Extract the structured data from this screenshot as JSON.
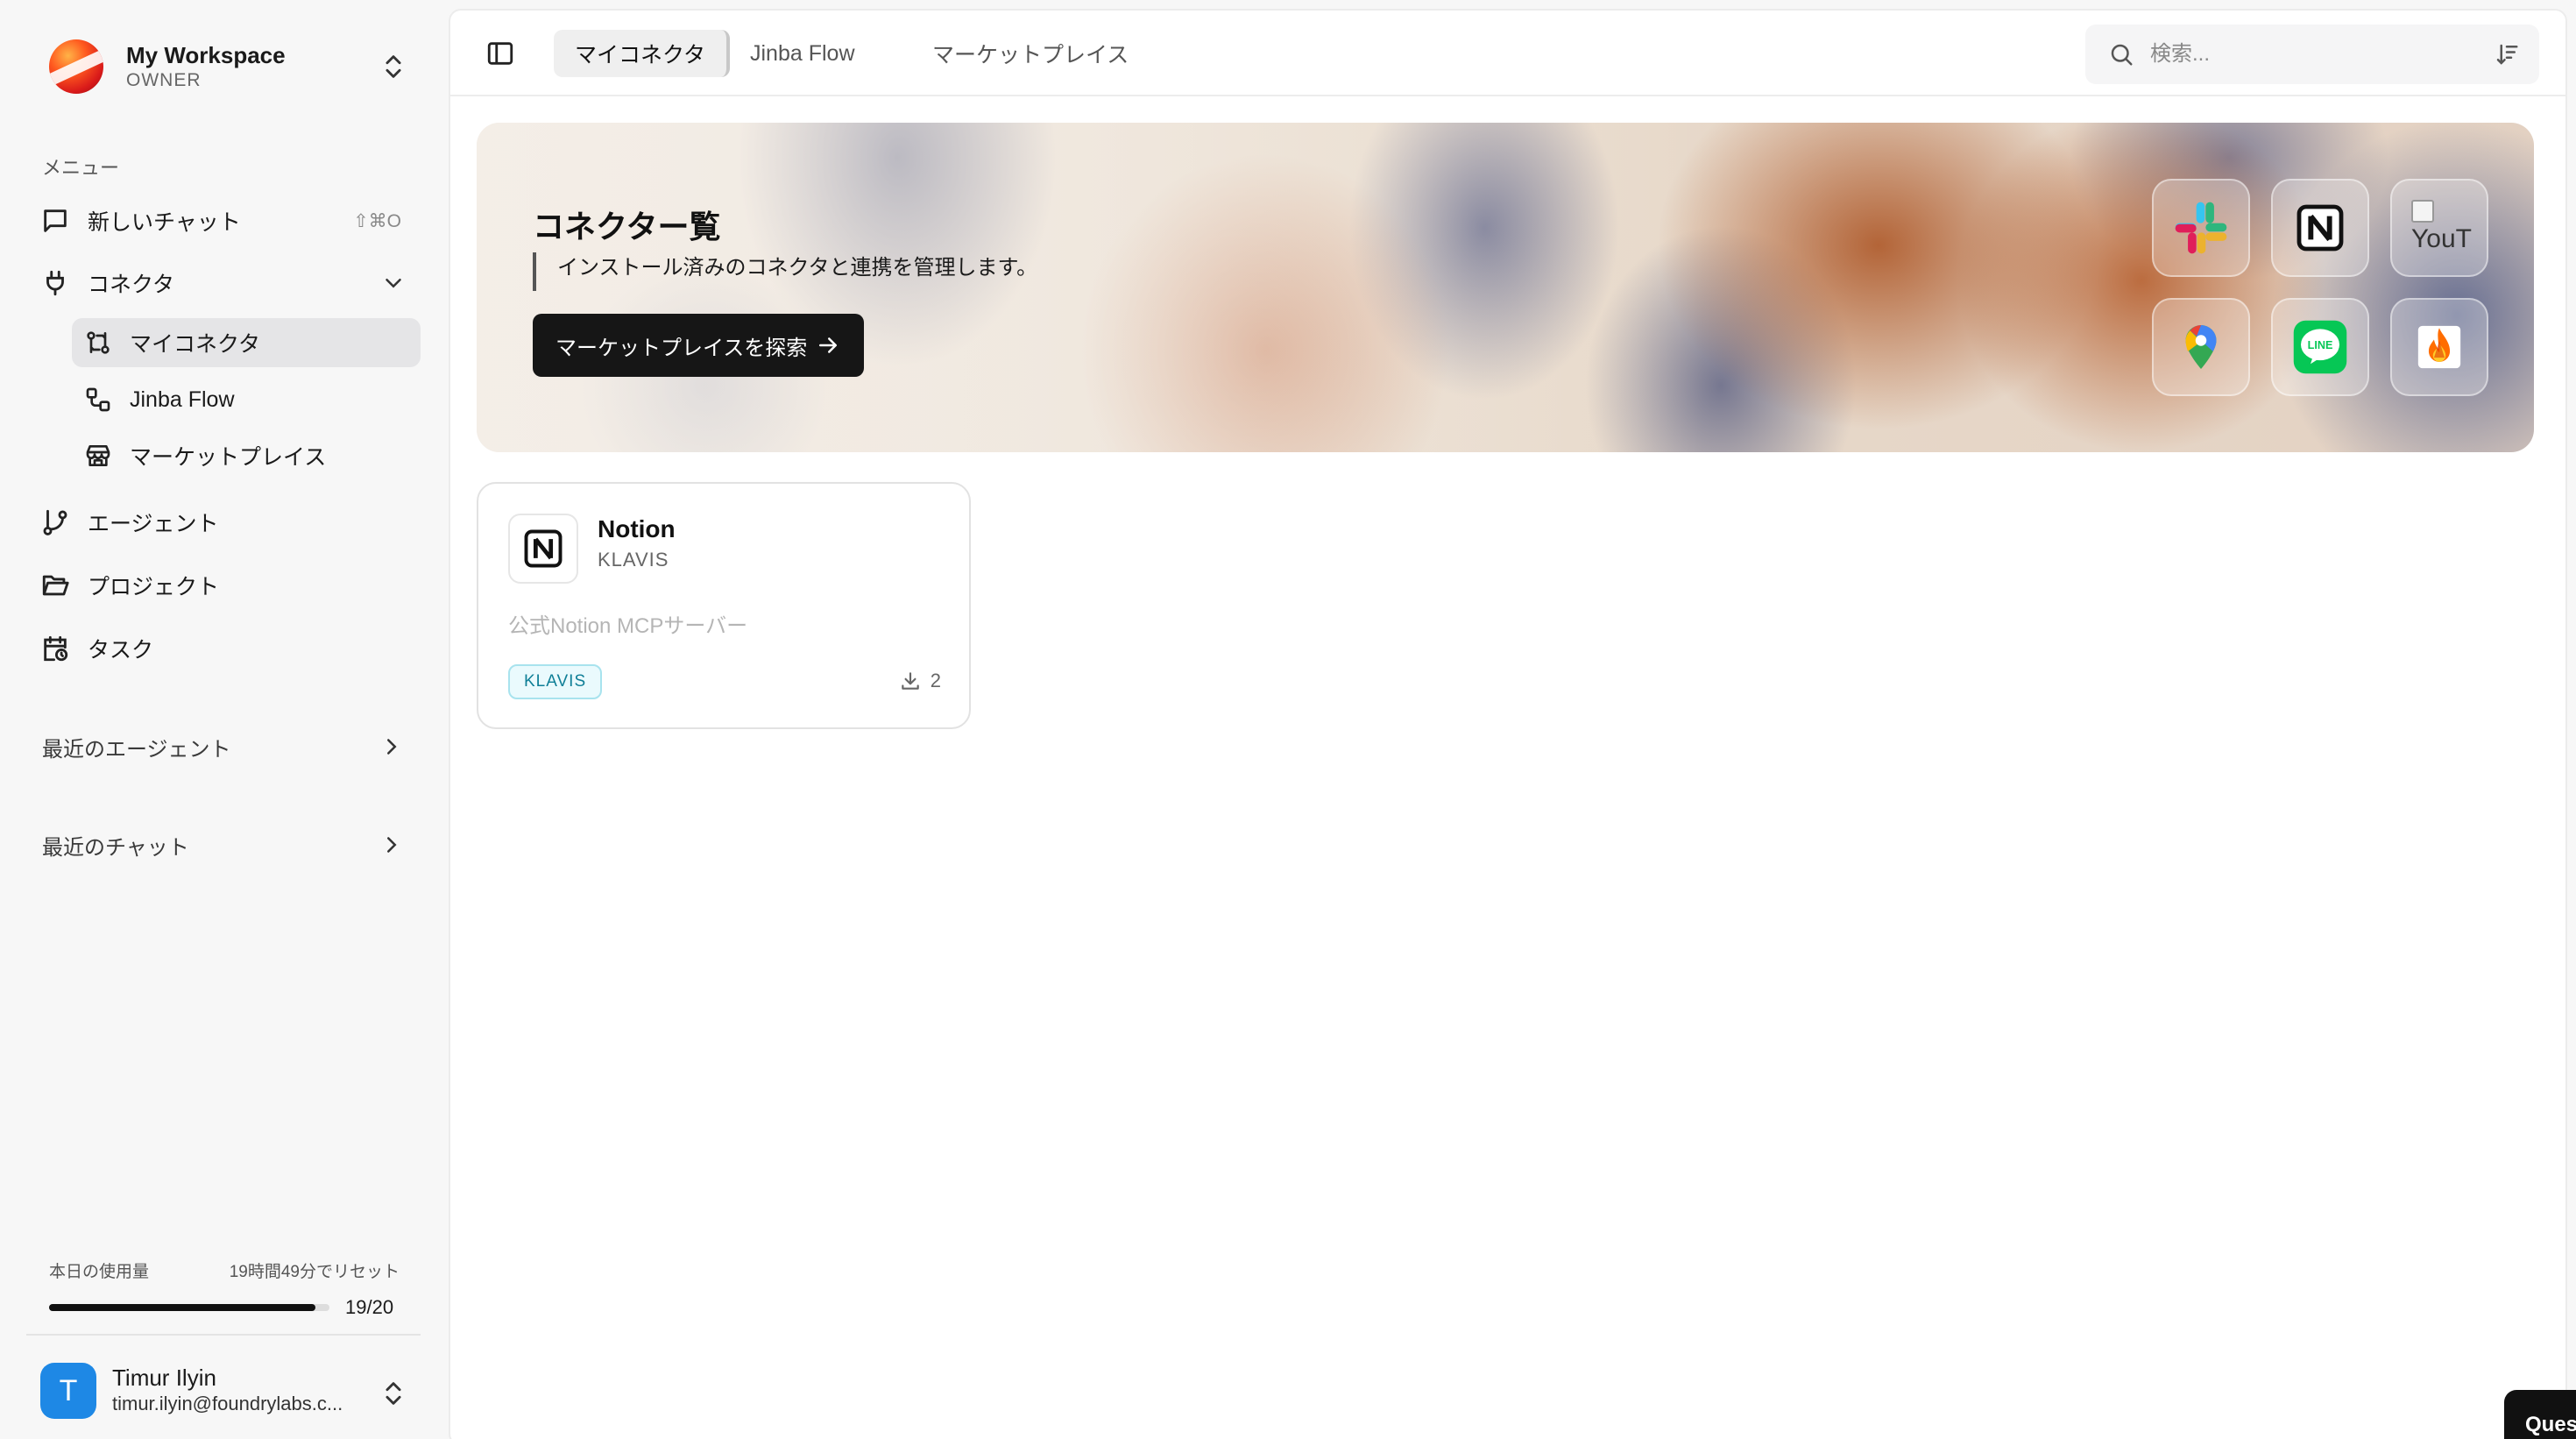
{
  "workspace": {
    "name": "My Workspace",
    "role": "OWNER"
  },
  "sidebar": {
    "menu_label": "メニュー",
    "new_chat": {
      "label": "新しいチャット",
      "shortcut": "⇧⌘O"
    },
    "connectors": {
      "label": "コネクタ",
      "items": [
        {
          "label": "マイコネクタ",
          "active": true
        },
        {
          "label": "Jinba Flow"
        },
        {
          "label": "マーケットプレイス"
        }
      ]
    },
    "agents": "エージェント",
    "projects": "プロジェクト",
    "tasks": "タスク",
    "recent_agents": "最近のエージェント",
    "recent_chats": "最近のチャット"
  },
  "usage": {
    "label": "本日の使用量",
    "reset": "19時間49分でリセット",
    "used": 19,
    "limit": 20,
    "count_text": "19/20"
  },
  "user": {
    "initial": "T",
    "name": "Timur Ilyin",
    "email": "timur.ilyin@foundrylabs.c..."
  },
  "topbar": {
    "tabs": [
      "マイコネクタ",
      "Jinba Flow",
      "マーケットプレイス"
    ],
    "active_tab": 0,
    "search_placeholder": "検索..."
  },
  "hero": {
    "title": "コネクター覧",
    "description": "インストール済みのコネクタと連携を管理します。",
    "button": "マーケットプレイスを探索",
    "apps": [
      "slack-icon",
      "notion-icon",
      "youtube-icon",
      "google-maps-icon",
      "line-icon",
      "firebase-icon"
    ],
    "broken_image_alt": "YouT"
  },
  "connectors": [
    {
      "name": "Notion",
      "provider": "KLAVIS",
      "description": "公式Notion MCPサーバー",
      "badge": "KLAVIS",
      "downloads": "2"
    }
  ],
  "floating_button": "Ques",
  "colors": {
    "accent": "#161616",
    "badge": "#0f7f97",
    "avatar": "#1e88e5"
  }
}
